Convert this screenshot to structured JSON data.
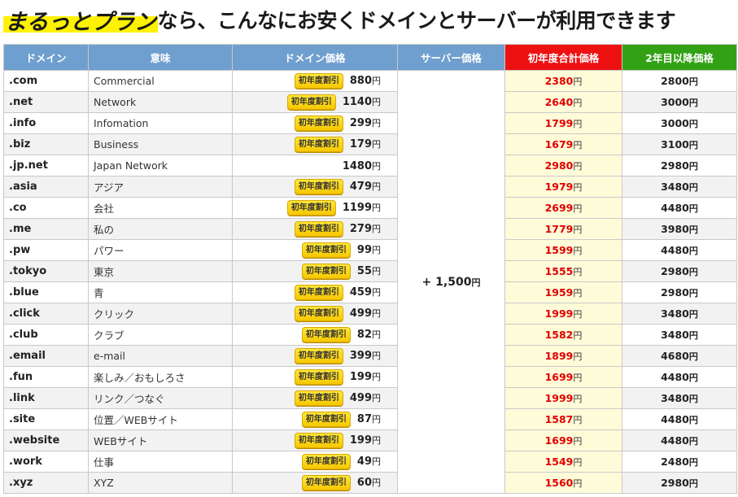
{
  "headline": {
    "emphasis": "まるっとプラン",
    "rest": "なら、こんなにお安くドメインとサーバーが利用できます"
  },
  "columns": {
    "domain": "ドメイン",
    "meaning": "意味",
    "domain_price": "ドメイン価格",
    "server_price": "サーバー価格",
    "first_year": "初年度合計価格",
    "second_year": "2年目以降価格"
  },
  "badge_label": "初年度割引",
  "yen": "円",
  "server_fee": {
    "prefix": "+ ",
    "amount": "1,500",
    "unit": "円"
  },
  "colors": {
    "header_blue": "#6f9fcf",
    "header_red": "#ee1111",
    "header_green": "#33a116",
    "highlight_yellow": "#fff200",
    "price_red": "#e00000"
  },
  "rows": [
    {
      "tld": ".com",
      "meaning": "Commercial",
      "badge": true,
      "domain_price": "880",
      "first_year": "2380",
      "second_year": "2800"
    },
    {
      "tld": ".net",
      "meaning": "Network",
      "badge": true,
      "domain_price": "1140",
      "first_year": "2640",
      "second_year": "3000"
    },
    {
      "tld": ".info",
      "meaning": "Infomation",
      "badge": true,
      "domain_price": "299",
      "first_year": "1799",
      "second_year": "3000"
    },
    {
      "tld": ".biz",
      "meaning": "Business",
      "badge": true,
      "domain_price": "179",
      "first_year": "1679",
      "second_year": "3100"
    },
    {
      "tld": ".jp.net",
      "meaning": "Japan Network",
      "badge": false,
      "domain_price": "1480",
      "first_year": "2980",
      "second_year": "2980"
    },
    {
      "tld": ".asia",
      "meaning": "アジア",
      "badge": true,
      "domain_price": "479",
      "first_year": "1979",
      "second_year": "3480"
    },
    {
      "tld": ".co",
      "meaning": "会社",
      "badge": true,
      "domain_price": "1199",
      "first_year": "2699",
      "second_year": "4480"
    },
    {
      "tld": ".me",
      "meaning": "私の",
      "badge": true,
      "domain_price": "279",
      "first_year": "1779",
      "second_year": "3980"
    },
    {
      "tld": ".pw",
      "meaning": "パワー",
      "badge": true,
      "domain_price": "99",
      "first_year": "1599",
      "second_year": "4480"
    },
    {
      "tld": ".tokyo",
      "meaning": "東京",
      "badge": true,
      "domain_price": "55",
      "first_year": "1555",
      "second_year": "2980"
    },
    {
      "tld": ".blue",
      "meaning": "青",
      "badge": true,
      "domain_price": "459",
      "first_year": "1959",
      "second_year": "2980"
    },
    {
      "tld": ".click",
      "meaning": "クリック",
      "badge": true,
      "domain_price": "499",
      "first_year": "1999",
      "second_year": "3480"
    },
    {
      "tld": ".club",
      "meaning": "クラブ",
      "badge": true,
      "domain_price": "82",
      "first_year": "1582",
      "second_year": "3480"
    },
    {
      "tld": ".email",
      "meaning": "e-mail",
      "badge": true,
      "domain_price": "399",
      "first_year": "1899",
      "second_year": "4680"
    },
    {
      "tld": ".fun",
      "meaning": "楽しみ／おもしろさ",
      "badge": true,
      "domain_price": "199",
      "first_year": "1699",
      "second_year": "4480"
    },
    {
      "tld": ".link",
      "meaning": "リンク／つなぐ",
      "badge": true,
      "domain_price": "499",
      "first_year": "1999",
      "second_year": "3480"
    },
    {
      "tld": ".site",
      "meaning": "位置／WEBサイト",
      "badge": true,
      "domain_price": "87",
      "first_year": "1587",
      "second_year": "4480"
    },
    {
      "tld": ".website",
      "meaning": "WEBサイト",
      "badge": true,
      "domain_price": "199",
      "first_year": "1699",
      "second_year": "4480"
    },
    {
      "tld": ".work",
      "meaning": "仕事",
      "badge": true,
      "domain_price": "49",
      "first_year": "1549",
      "second_year": "2480"
    },
    {
      "tld": ".xyz",
      "meaning": "XYZ",
      "badge": true,
      "domain_price": "60",
      "first_year": "1560",
      "second_year": "2980"
    }
  ]
}
